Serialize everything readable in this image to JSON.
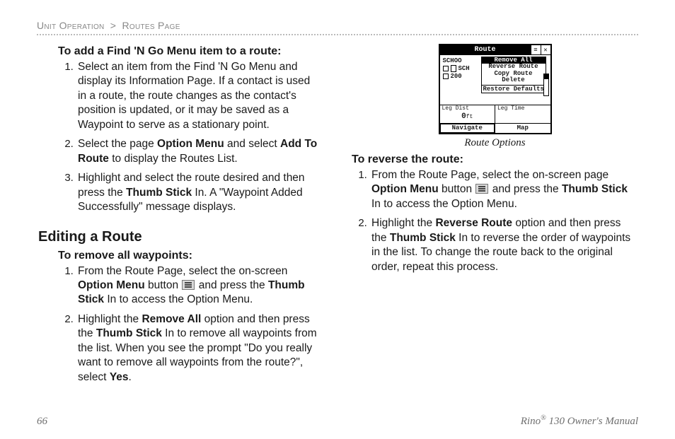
{
  "breadcrumb": {
    "a": "Unit Operation",
    "sep": ">",
    "b": "Routes Page"
  },
  "left": {
    "sec1_title": "To add a Find 'N Go Menu item to a route:",
    "sec1_step1": "Select an item from the Find 'N Go Menu and display its Information Page. If a contact is used in a route, the route changes as the contact's position is updated, or it may be saved as a Waypoint to serve as a stationary point.",
    "sec1_step2_a": "Select the page ",
    "sec1_step2_b1": "Option Menu",
    "sec1_step2_c": " and select ",
    "sec1_step2_b2": "Add To Route",
    "sec1_step2_d": " to display the Routes List.",
    "sec1_step3_a": "Highlight and select the route desired and then press the ",
    "sec1_step3_b": "Thumb Stick",
    "sec1_step3_c": " In. A \"Waypoint Added Successfully\" message displays.",
    "subhead": "Editing a Route",
    "sec2_title": "To remove all waypoints:",
    "sec2_step1_a": "From the Route Page, select the on-screen ",
    "sec2_step1_b1": "Option Menu",
    "sec2_step1_c": " button ",
    "sec2_step1_d": " and press the ",
    "sec2_step1_b2": "Thumb Stick",
    "sec2_step1_e": " In to access the Option Menu.",
    "sec2_step2_a": "Highlight the ",
    "sec2_step2_b1": "Remove All",
    "sec2_step2_c": " option and then press the ",
    "sec2_step2_b2": "Thumb Stick",
    "sec2_step2_d": " In to remove all waypoints from the list. When you see the prompt \"Do you really want to remove all waypoints from the route?\", select ",
    "sec2_step2_b3": "Yes",
    "sec2_step2_e": "."
  },
  "right": {
    "caption": "Route Options",
    "sec3_title": "To reverse the route:",
    "sec3_step1_a": "From the Route Page, select the on-screen page ",
    "sec3_step1_b1": "Option Menu",
    "sec3_step1_c": " button ",
    "sec3_step1_d": " and press the ",
    "sec3_step1_b2": "Thumb Stick",
    "sec3_step1_e": " In to access the Option Menu.",
    "sec3_step2_a": "Highlight the ",
    "sec3_step2_b1": "Reverse Route",
    "sec3_step2_c": " option and then press the ",
    "sec3_step2_b2": "Thumb Stick",
    "sec3_step2_d": " In to reverse the order of waypoints in the list. To change the route back to the original order, repeat this process."
  },
  "device": {
    "title": "Route",
    "row1": "SCHOO",
    "row2a": "SCH",
    "row2b": "200",
    "dd1": "Remove All",
    "dd2": "Reverse Route",
    "dd3": "Copy Route",
    "dd4": "Delete",
    "dd5": "Restore Defaults",
    "leg_dist_label": "Leg Dist",
    "leg_dist_val": "0",
    "leg_dist_unit": "ft",
    "leg_time_label": "Leg Time",
    "leg_time_val": " ",
    "tab1": "Navigate",
    "tab2": "Map"
  },
  "footer": {
    "page": "66",
    "brand": "Rino",
    "reg": "®",
    "model": " 130 Owner's Manual"
  }
}
